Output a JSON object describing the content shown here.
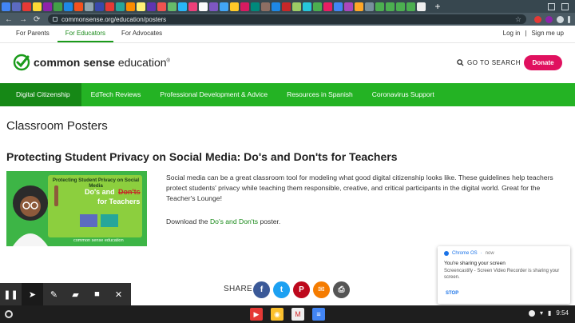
{
  "browser": {
    "url": "commonsense.org/education/posters",
    "tab_icon_colors": [
      "#4285f4",
      "#5c6bc0",
      "#e53935",
      "#fdd835",
      "#8e24aa",
      "#43a047",
      "#1e88e5",
      "#f4511e",
      "#90a4ae",
      "#3949ab",
      "#e53935",
      "#26a69a",
      "#fb8c00",
      "#fff176",
      "#5e35b1",
      "#ef5350",
      "#66bb6a",
      "#29b6f6",
      "#ec407a",
      "#fafafa",
      "#7e57c2",
      "#42a5f5",
      "#ffca28",
      "#d81b60",
      "#00897b",
      "#8d6e63",
      "#1e88e5",
      "#c62828",
      "#9ccc65",
      "#26c6da",
      "#4caf50",
      "#e91e63",
      "#4285f4",
      "#ab47bc",
      "#ffa726",
      "#78909c",
      "#4caf50",
      "#4caf50",
      "#4caf50",
      "#4caf50",
      "#eeeeee"
    ],
    "new_tab_label": "+"
  },
  "audience_nav": {
    "items": [
      "For Parents",
      "For Educators",
      "For Advocates"
    ],
    "active_index": 1,
    "login_label": "Log in",
    "separator": "|",
    "signup_label": "Sign me up"
  },
  "header": {
    "brand_bold": "common sense",
    "brand_rest": " education",
    "trademark": "®",
    "search_label": "GO TO SEARCH",
    "donate_label": "Donate"
  },
  "main_nav": {
    "items": [
      "Digital Citizenship",
      "EdTech Reviews",
      "Professional Development & Advice",
      "Resources in Spanish",
      "Coronavirus Support"
    ],
    "active_index": 0
  },
  "content": {
    "page_title": "Classroom Posters",
    "post_title": "Protecting Student Privacy on Social Media: Do's and Don'ts for Teachers",
    "description": "Social media can be a great classroom tool for modeling what good digital citizenship looks like. These guidelines help teachers protect students' privacy while teaching them responsible, creative, and critical participants in the digital world. Great for the Teacher's Lounge!",
    "download_prefix": "Download the ",
    "download_link": "Do's and Don'ts",
    "download_suffix": " poster.",
    "poster": {
      "headline": "Protecting Student Privacy on Social Media",
      "dos": "Do's and",
      "donts": "Don'ts",
      "for_teachers": "for Teachers",
      "brand": "common sense education"
    }
  },
  "share": {
    "label": "SHARE",
    "buttons": [
      {
        "name": "facebook",
        "glyph": "f",
        "color": "#3b5998"
      },
      {
        "name": "twitter",
        "glyph": "t",
        "color": "#1da1f2"
      },
      {
        "name": "pinterest",
        "glyph": "P",
        "color": "#bd081c"
      },
      {
        "name": "email",
        "glyph": "✉",
        "color": "#f57c00"
      },
      {
        "name": "print",
        "glyph": "⎙",
        "color": "#555555"
      }
    ]
  },
  "recorder": {
    "tools": [
      "pause",
      "pointer",
      "pen",
      "highlighter",
      "camera",
      "close"
    ]
  },
  "notification": {
    "source": "Chrome OS",
    "time": "now",
    "title": "You're sharing your screen",
    "body": "Screencastify - Screen Video Recorder is sharing your screen.",
    "action": "STOP"
  },
  "shelf": {
    "apps": [
      {
        "name": "youtube",
        "color": "#e53935",
        "glyph": "▶"
      },
      {
        "name": "chrome",
        "color": "#fbc02d",
        "glyph": "◉"
      },
      {
        "name": "gmail",
        "color": "#eeeeee",
        "glyph": "M"
      },
      {
        "name": "docs",
        "color": "#4285f4",
        "glyph": "≡"
      }
    ],
    "clock": "9:54"
  }
}
